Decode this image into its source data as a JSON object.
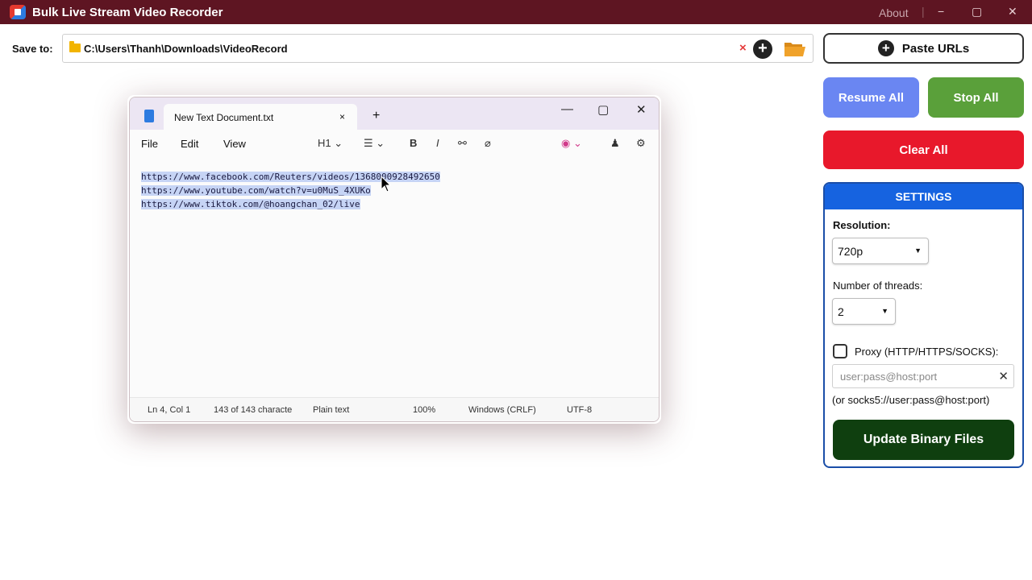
{
  "window": {
    "title": "Bulk Live Stream Video Recorder",
    "about": "About",
    "separator": "|",
    "minimize": "−",
    "maximize": "▢",
    "close": "✕"
  },
  "save": {
    "label": "Save to:",
    "path": "C:\\Users\\Thanh\\Downloads\\VideoRecord",
    "clear": "×",
    "add": "+"
  },
  "buttons": {
    "paste": "Paste URLs",
    "resume": "Resume All",
    "stop": "Stop All",
    "clear": "Clear All"
  },
  "settings": {
    "title": "SETTINGS",
    "resolution_label": "Resolution:",
    "resolution_value": "720p",
    "threads_label": "Number of threads:",
    "threads_value": "2",
    "proxy_label": "Proxy (HTTP/HTTPS/SOCKS):",
    "proxy_placeholder": "user:pass@host:port",
    "proxy_hint": "(or socks5://user:pass@host:port)",
    "update": "Update Binary Files"
  },
  "notepad": {
    "tab_title": "New Text Document.txt",
    "tab_close": "×",
    "new_tab": "+",
    "menus": [
      "File",
      "Edit",
      "View"
    ],
    "heading": "H1",
    "bold": "B",
    "italic": "I",
    "lines": [
      "https://www.facebook.com/Reuters/videos/1368000928492650",
      "https://www.youtube.com/watch?v=u0MuS_4XUKo",
      "https://www.tiktok.com/@hoangchan_02/live"
    ],
    "status": {
      "position": "Ln 4, Col 1",
      "chars": "143 of 143 characte",
      "mode": "Plain text",
      "zoom": "100%",
      "eol": "Windows (CRLF)",
      "encoding": "UTF-8"
    }
  },
  "colors": {
    "titlebar": "#5e1522",
    "resume": "#6a86f2",
    "stop": "#5aa03a",
    "clear": "#e8182b",
    "settings": "#1663e0",
    "update": "#0f3f0f"
  }
}
